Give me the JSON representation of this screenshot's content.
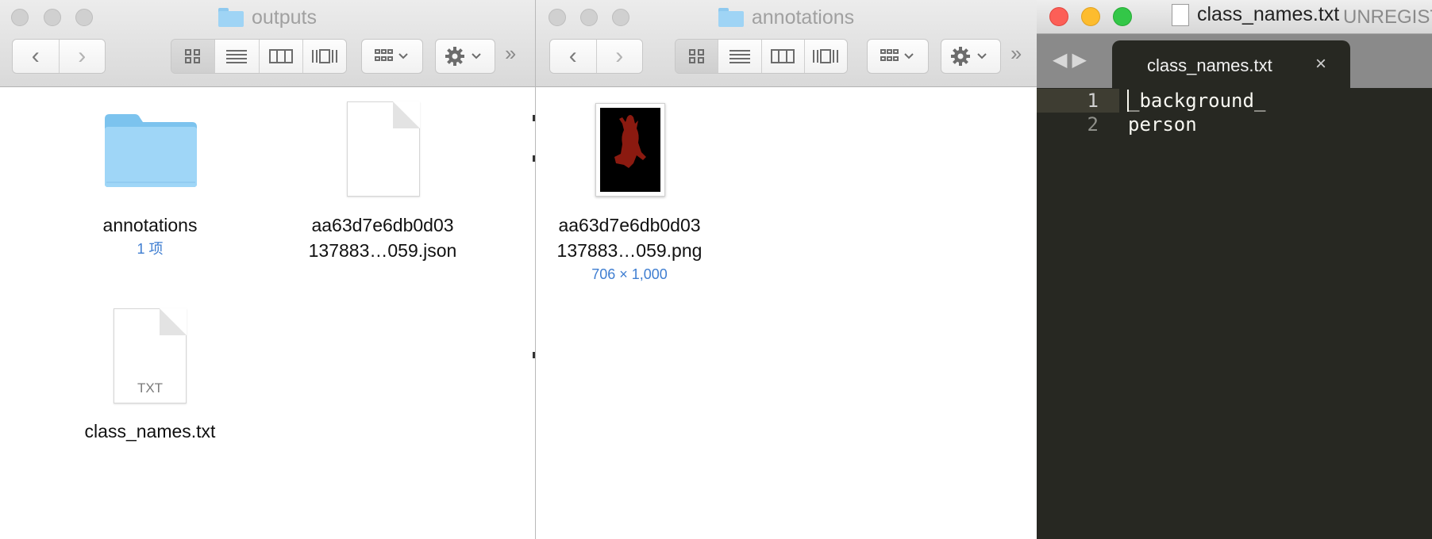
{
  "finder_outputs": {
    "title": "outputs",
    "items": [
      {
        "name": "annotations",
        "subtitle": "1 项"
      },
      {
        "name_line1": "aa63d7e6db0d03",
        "name_line2": "137883…059.json"
      },
      {
        "name": "class_names.txt",
        "icon_label": "TXT"
      }
    ]
  },
  "finder_annotations": {
    "title": "annotations",
    "items": [
      {
        "name_line1": "aa63d7e6db0d03",
        "name_line2": "137883…059.png",
        "subtitle": "706 × 1,000"
      }
    ]
  },
  "editor": {
    "window_title": "class_names.txt",
    "unregistered": "UNREGIST",
    "tab_label": "class_names.txt",
    "close_glyph": "×",
    "lines": [
      {
        "number": "1",
        "text": "_background_"
      },
      {
        "number": "2",
        "text": "person"
      }
    ]
  },
  "colors": {
    "close_red": "#fc5f57",
    "minimize_yellow": "#fdbc2e",
    "zoom_green": "#33c748",
    "editor_bg": "#272822",
    "finder_subtitle_blue": "#3f7ed1",
    "folder_blue": "#8fd0f7",
    "mask_red": "#8b1a10"
  },
  "icons": [
    "folder-icon",
    "back-chevron-icon",
    "forward-chevron-icon",
    "icon-view-icon",
    "list-view-icon",
    "column-view-icon",
    "cover-flow-icon",
    "arrange-icon",
    "gear-icon",
    "more-icon",
    "document-icon"
  ]
}
